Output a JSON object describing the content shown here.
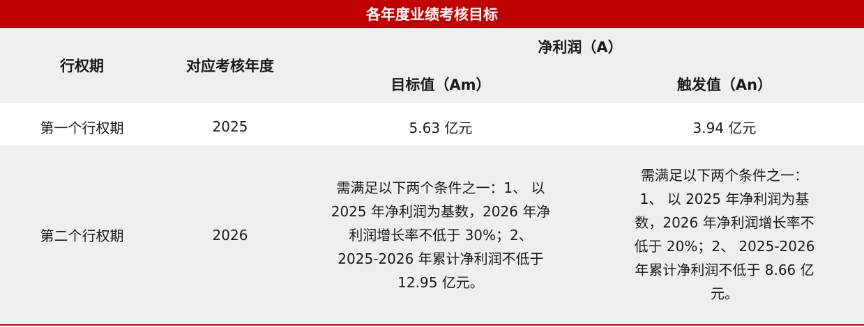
{
  "table": {
    "title": "各年度业绩考核目标",
    "headers": {
      "period": "行权期",
      "year": "对应考核年度",
      "net_profit_group": "净利润（A）",
      "target": "目标值（Am）",
      "trigger": "触发值（An）"
    },
    "rows": [
      {
        "period": "第一个行权期",
        "year": "2025",
        "target": "5.63 亿元",
        "trigger": "3.94 亿元"
      },
      {
        "period": "第二个行权期",
        "year": "2026",
        "target": "需满足以下两个条件之一：1、 以\n2025 年净利润为基数，2026 年净\n利润增长率不低于 30%；2、\n2025-2026 年累计净利润不低于\n12.95 亿元。",
        "trigger": "需满足以下两个条件之一：\n1、 以 2025 年净利润为基\n数，2026 年净利润增长率不\n低于 20%；2、 2025-2026\n年累计净利润不低于 8.66 亿\n元。"
      }
    ]
  },
  "colors": {
    "title_bg": "#c00000",
    "band_gray": "#efefef"
  }
}
